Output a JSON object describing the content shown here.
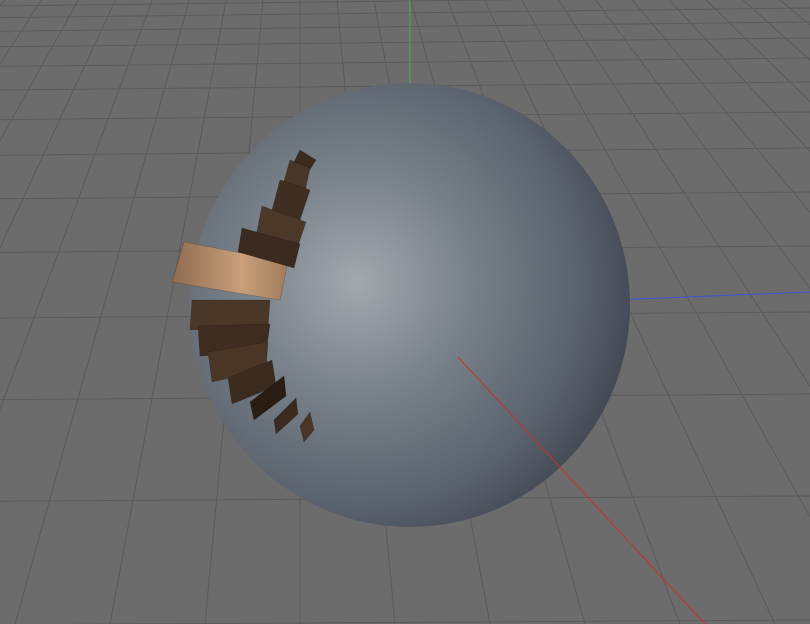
{
  "viewport": {
    "background": "#6c6c6c",
    "grid_color": "#5a5a5a"
  },
  "axes": {
    "x_axis_color": "#c83030",
    "y_axis_color": "#3fb84a",
    "z_axis_color": "#3a55d6"
  },
  "object": {
    "type": "sphere",
    "base_color": "#5b6470",
    "highlight_color": "#a3a9ae",
    "segments": {
      "count": 11,
      "colors": [
        "#3a2a1f",
        "#4a3626",
        "#3f2e22",
        "#4b3828",
        "#c49a75",
        "#3b2a20",
        "#4a3727",
        "#3f2d21",
        "#4a3626",
        "#3c2b1f",
        "#2a1d14"
      ]
    }
  }
}
